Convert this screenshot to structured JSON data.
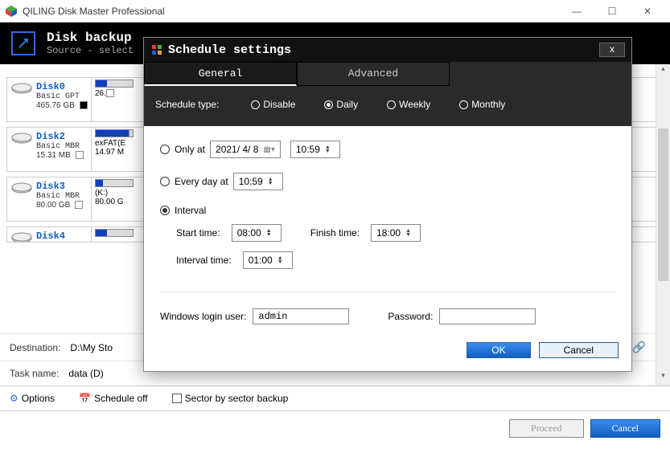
{
  "window": {
    "title": "QILING Disk Master Professional"
  },
  "header": {
    "title": "Disk backup",
    "subtitle": "Source - select"
  },
  "disks": [
    {
      "name": "Disk0",
      "type": "Basic GPT",
      "size": "465.76 GB",
      "part_label": "26."
    },
    {
      "name": "Disk2",
      "type": "Basic MBR",
      "size": "15.31 MB",
      "part_label": "exFAT(E",
      "part_size": "14.97 M"
    },
    {
      "name": "Disk3",
      "type": "Basic MBR",
      "size": "80.00 GB",
      "part_label": "(K:)",
      "part_size": "80.00 G"
    },
    {
      "name": "Disk4",
      "type": "",
      "size": "",
      "part_label": ""
    }
  ],
  "config": {
    "dest_label": "Destination:",
    "dest_value": "D:\\My Sto",
    "task_label": "Task name:",
    "task_value": "data (D)"
  },
  "bottom": {
    "options": "Options",
    "schedule": "Schedule off",
    "sector": "Sector by sector backup"
  },
  "footer": {
    "proceed": "Proceed",
    "cancel": "Cancel"
  },
  "modal": {
    "title": "Schedule settings",
    "tabs": {
      "general": "General",
      "advanced": "Advanced"
    },
    "sched_type_label": "Schedule type:",
    "types": {
      "disable": "Disable",
      "daily": "Daily",
      "weekly": "Weekly",
      "monthly": "Monthly"
    },
    "only_at": "Only at",
    "only_date": "2021/ 4/ 8",
    "only_time": "10:59",
    "every_day": "Every day at",
    "every_time": "10:59",
    "interval": "Interval",
    "start_label": "Start time:",
    "start_val": "08:00",
    "finish_label": "Finish time:",
    "finish_val": "18:00",
    "interval_label": "Interval time:",
    "interval_val": "01:00",
    "login_label": "Windows login user:",
    "login_val": "admin",
    "pass_label": "Password:",
    "ok": "OK",
    "cancel": "Cancel"
  }
}
